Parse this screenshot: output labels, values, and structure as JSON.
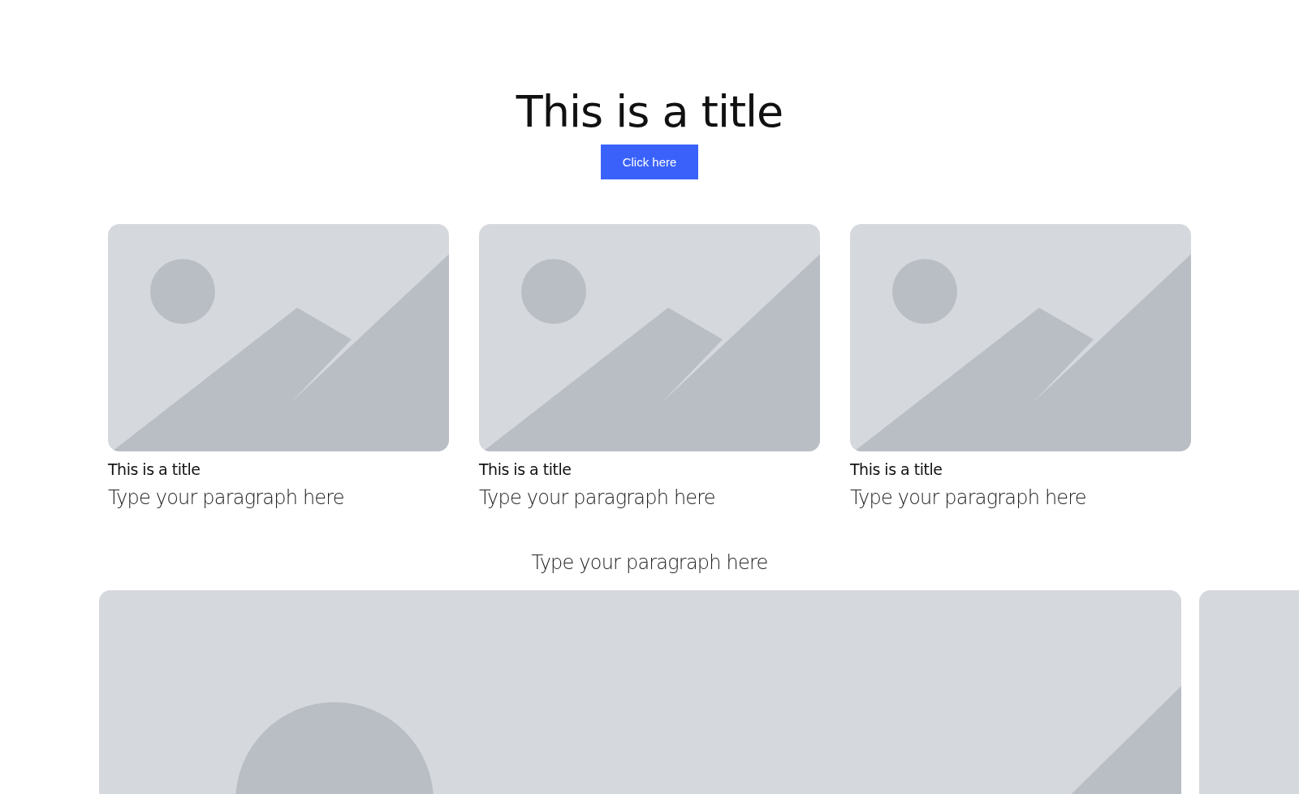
{
  "header": {
    "title": "This is a title",
    "button": "Click here"
  },
  "cards": [
    {
      "title": "This is a title",
      "paragraph": "Type your paragraph here"
    },
    {
      "title": "This is a title",
      "paragraph": "Type your paragraph here"
    },
    {
      "title": "This is a title",
      "paragraph": "Type your paragraph here"
    }
  ],
  "gallery": {
    "caption": "Type your paragraph here"
  }
}
